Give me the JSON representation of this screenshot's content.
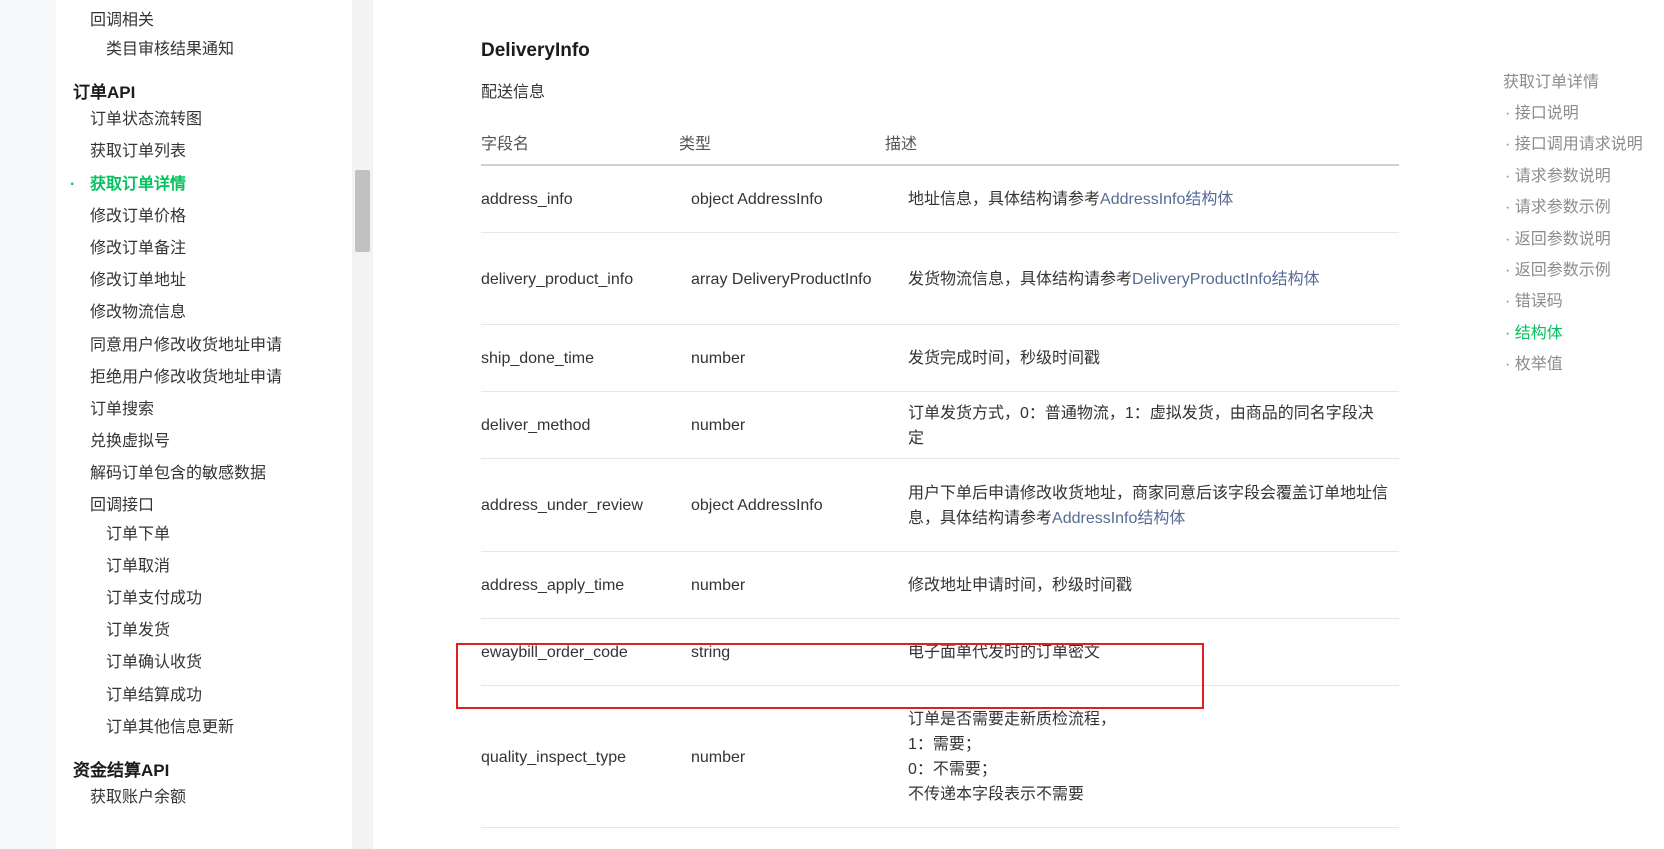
{
  "sidebar": {
    "items": [
      {
        "label": "回调相关",
        "level": "l2"
      },
      {
        "label": "类目审核结果通知",
        "level": "l3"
      },
      {
        "label": "订单API",
        "level": "group"
      },
      {
        "label": "订单状态流转图",
        "level": "l2"
      },
      {
        "label": "获取订单列表",
        "level": "l2"
      },
      {
        "label": "获取订单详情",
        "level": "l2",
        "active": true
      },
      {
        "label": "修改订单价格",
        "level": "l2"
      },
      {
        "label": "修改订单备注",
        "level": "l2"
      },
      {
        "label": "修改订单地址",
        "level": "l2"
      },
      {
        "label": "修改物流信息",
        "level": "l2"
      },
      {
        "label": "同意用户修改收货地址申请",
        "level": "l2"
      },
      {
        "label": "拒绝用户修改收货地址申请",
        "level": "l2"
      },
      {
        "label": "订单搜索",
        "level": "l2"
      },
      {
        "label": "兑换虚拟号",
        "level": "l2"
      },
      {
        "label": "解码订单包含的敏感数据",
        "level": "l2"
      },
      {
        "label": "回调接口",
        "level": "l2"
      },
      {
        "label": "订单下单",
        "level": "l3"
      },
      {
        "label": "订单取消",
        "level": "l3"
      },
      {
        "label": "订单支付成功",
        "level": "l3"
      },
      {
        "label": "订单发货",
        "level": "l3"
      },
      {
        "label": "订单确认收货",
        "level": "l3"
      },
      {
        "label": "订单结算成功",
        "level": "l3"
      },
      {
        "label": "订单其他信息更新",
        "level": "l3"
      },
      {
        "label": "资金结算API",
        "level": "group"
      },
      {
        "label": "获取账户余额",
        "level": "l2"
      }
    ],
    "active_marker": "·"
  },
  "main": {
    "title": "DeliveryInfo",
    "description": "配送信息",
    "headers": [
      "字段名",
      "类型",
      "描述"
    ],
    "rows": [
      {
        "field": "address_info",
        "type": "object AddressInfo",
        "desc": "地址信息，具体结构请参考",
        "link": "AddressInfo结构体"
      },
      {
        "field": "delivery_product_info",
        "type": "array DeliveryProductInfo",
        "desc": "发货物流信息，具体结构请参考",
        "link": "DeliveryProductInfo结构体"
      },
      {
        "field": "ship_done_time",
        "type": "number",
        "desc": "发货完成时间，秒级时间戳",
        "link": ""
      },
      {
        "field": "deliver_method",
        "type": "number",
        "desc": "订单发货方式，0：普通物流，1：虚拟发货，由商品的同名字段决定",
        "link": ""
      },
      {
        "field": "address_under_review",
        "type": "object AddressInfo",
        "desc": "用户下单后申请修改收货地址，商家同意后该字段会覆盖订单地址信息，具体结构请参考",
        "link": "AddressInfo结构体"
      },
      {
        "field": "address_apply_time",
        "type": "number",
        "desc": "修改地址申请时间，秒级时间戳",
        "link": ""
      },
      {
        "field": "ewaybill_order_code",
        "type": "string",
        "desc": "电子面单代发时的订单密文",
        "link": ""
      },
      {
        "field": "quality_inspect_type",
        "type": "number",
        "desc": "订单是否需要走新质检流程，\n1：需要；\n0：不需要；\n不传递本字段表示不需要",
        "link": ""
      }
    ]
  },
  "toc": {
    "title": "获取订单详情",
    "items": [
      {
        "label": "· 接口说明"
      },
      {
        "label": "· 接口调用请求说明"
      },
      {
        "label": "· 请求参数说明"
      },
      {
        "label": "· 请求参数示例"
      },
      {
        "label": "· 返回参数说明"
      },
      {
        "label": "· 返回参数示例"
      },
      {
        "label": "· 错误码"
      },
      {
        "label": "· 结构体",
        "active": true
      },
      {
        "label": "· 枚举值"
      }
    ]
  },
  "colors": {
    "accent": "#07c160",
    "link": "#576b95",
    "highlight": "#e02020"
  }
}
